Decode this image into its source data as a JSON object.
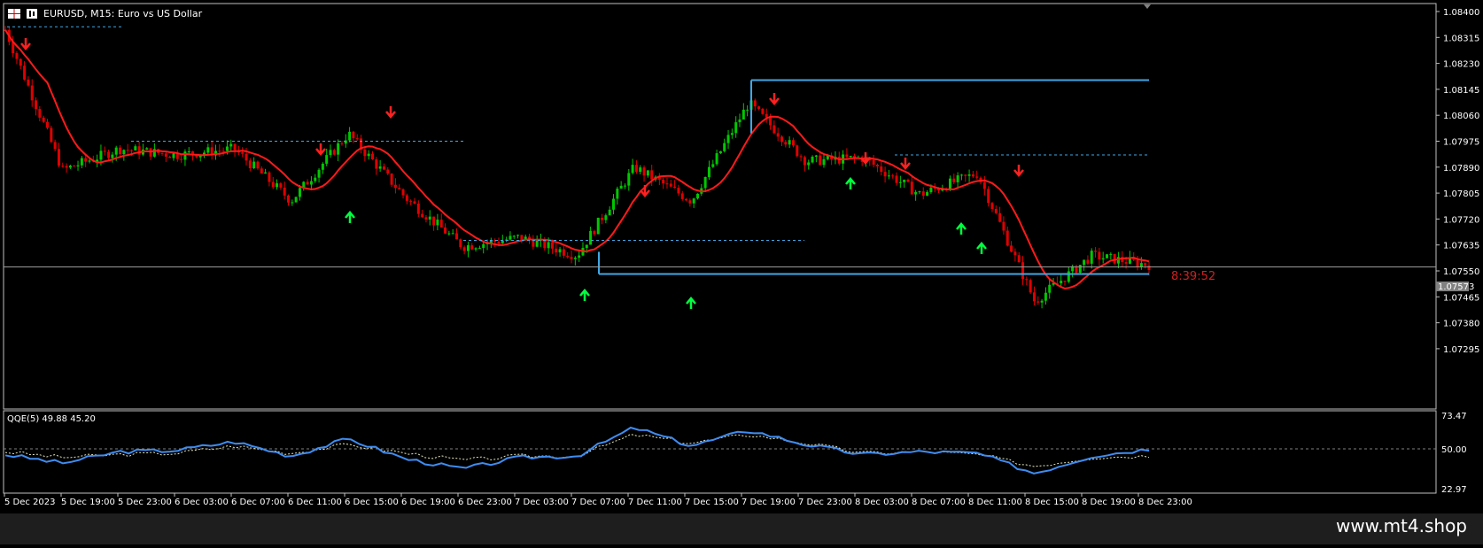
{
  "window": {
    "title": "EURUSD, M15:  Euro vs US Dollar",
    "symbol": "EURUSD",
    "timeframe": "M15"
  },
  "price_axis": {
    "labels": [
      "1.08400",
      "1.08315",
      "1.08230",
      "1.08145",
      "1.08060",
      "1.07975",
      "1.07890",
      "1.07805",
      "1.07720",
      "1.07635",
      "1.07550",
      "1.07465",
      "1.07380",
      "1.07295"
    ],
    "current_price_label": "1.07573"
  },
  "countdown": "8:39:52",
  "indicator": {
    "label": "QQE(5) 49.88 45.20",
    "axis_labels": [
      "73.47",
      "50.00",
      "22.97"
    ]
  },
  "time_axis": {
    "labels": [
      "5 Dec 2023",
      "5 Dec 19:00",
      "5 Dec 23:00",
      "6 Dec 03:00",
      "6 Dec 07:00",
      "6 Dec 11:00",
      "6 Dec 15:00",
      "6 Dec 19:00",
      "6 Dec 23:00",
      "7 Dec 03:00",
      "7 Dec 07:00",
      "7 Dec 11:00",
      "7 Dec 15:00",
      "7 Dec 19:00",
      "7 Dec 23:00",
      "8 Dec 03:00",
      "8 Dec 07:00",
      "8 Dec 11:00",
      "8 Dec 15:00",
      "8 Dec 19:00",
      "8 Dec 23:00"
    ]
  },
  "watermark": "www.mt4.shop",
  "colors": {
    "background": "#000000",
    "bull_candle": "#00c800",
    "bear_candle": "#e00000",
    "ma_line": "#ff1a1a",
    "level_line": "#3fa8e6",
    "qqe_line": "#3f8cf0",
    "up_arrow": "#00ff40",
    "down_arrow": "#ff2020",
    "countdown": "#d02020"
  },
  "chart_data": [
    {
      "type": "line",
      "title": "EURUSD, M15:  Euro vs US Dollar",
      "x": [
        "5 Dec 2023",
        "5 Dec 19:00",
        "5 Dec 23:00",
        "6 Dec 03:00",
        "6 Dec 07:00",
        "6 Dec 11:00",
        "6 Dec 15:00",
        "6 Dec 19:00",
        "6 Dec 23:00",
        "7 Dec 03:00",
        "7 Dec 07:00",
        "7 Dec 11:00",
        "7 Dec 15:00",
        "7 Dec 19:00",
        "7 Dec 23:00",
        "8 Dec 03:00",
        "8 Dec 07:00",
        "8 Dec 11:00",
        "8 Dec 15:00",
        "8 Dec 19:00",
        "8 Dec 23:00"
      ],
      "series": [
        {
          "values": [
            1.0834,
            1.0788,
            1.0795,
            1.0793,
            1.0795,
            1.0778,
            1.08,
            1.0779,
            1.0763,
            1.0766,
            1.076,
            1.0789,
            1.0778,
            1.081,
            1.0791,
            1.0792,
            1.078,
            1.0787,
            1.0745,
            1.076,
            1.0757
          ]
        }
      ],
      "levels": [
        1.08175,
        1.07563,
        1.0754
      ],
      "ylim": [
        1.0725,
        1.0843
      ],
      "grid": false
    },
    {
      "type": "line",
      "title": "QQE(5) 49.88 45.20",
      "x": [
        "5 Dec 2023",
        "5 Dec 19:00",
        "5 Dec 23:00",
        "6 Dec 03:00",
        "6 Dec 07:00",
        "6 Dec 11:00",
        "6 Dec 15:00",
        "6 Dec 19:00",
        "6 Dec 23:00",
        "7 Dec 03:00",
        "7 Dec 07:00",
        "7 Dec 11:00",
        "7 Dec 15:00",
        "7 Dec 19:00",
        "7 Dec 23:00",
        "8 Dec 03:00",
        "8 Dec 07:00",
        "8 Dec 11:00",
        "8 Dec 15:00",
        "8 Dec 19:00",
        "8 Dec 23:00"
      ],
      "series": [
        {
          "values": [
            46,
            40,
            48,
            49,
            55,
            45,
            57,
            43,
            36,
            44,
            45,
            65,
            52,
            63,
            53,
            46,
            48,
            47,
            33,
            45,
            49.88
          ]
        },
        {
          "values": [
            48,
            44,
            46,
            47,
            52,
            47,
            53,
            47,
            42,
            45,
            45,
            60,
            54,
            60,
            54,
            47,
            48,
            46,
            38,
            44,
            45.2
          ]
        }
      ],
      "ylim": [
        20,
        76
      ],
      "grid": false
    }
  ]
}
